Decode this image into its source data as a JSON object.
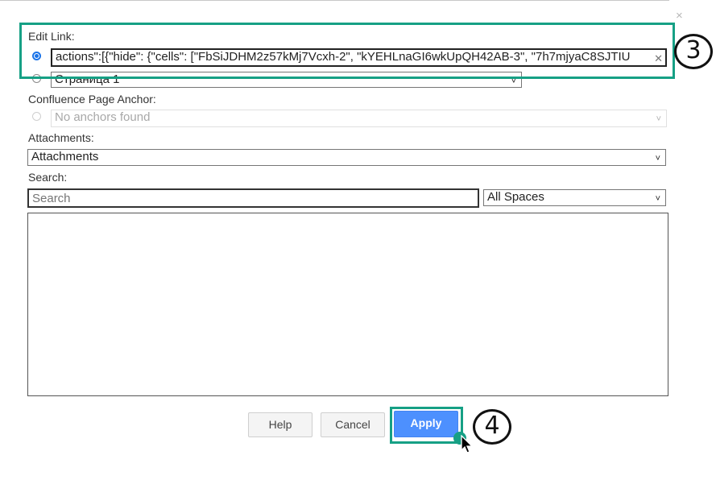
{
  "dialog": {
    "close_glyph": "×",
    "edit_link_label": "Edit Link:",
    "edit_link_value": "actions\":[{\"hide\": {\"cells\": [\"FbSiJDHM2z57kMj7Vcxh-2\", \"kYEHLnaGI6wkUpQH42AB-3\", \"7h7mjyaC8SJTIU",
    "page_select_value": "Страница 1",
    "anchor_label": "Confluence Page Anchor:",
    "anchor_select_value": "No anchors found",
    "attachments_label": "Attachments:",
    "attachments_select_value": "Attachments",
    "search_label": "Search:",
    "search_placeholder": "Search",
    "spaces_select_value": "All Spaces",
    "buttons": {
      "help": "Help",
      "cancel": "Cancel",
      "apply": "Apply"
    }
  },
  "annotations": {
    "step3": "3",
    "step4": "4",
    "highlight_color": "#16a085"
  },
  "icons": {
    "chevron": "chevron-down-icon",
    "clear": "clear-icon",
    "close": "close-icon",
    "cursor": "mouse-cursor-icon"
  }
}
